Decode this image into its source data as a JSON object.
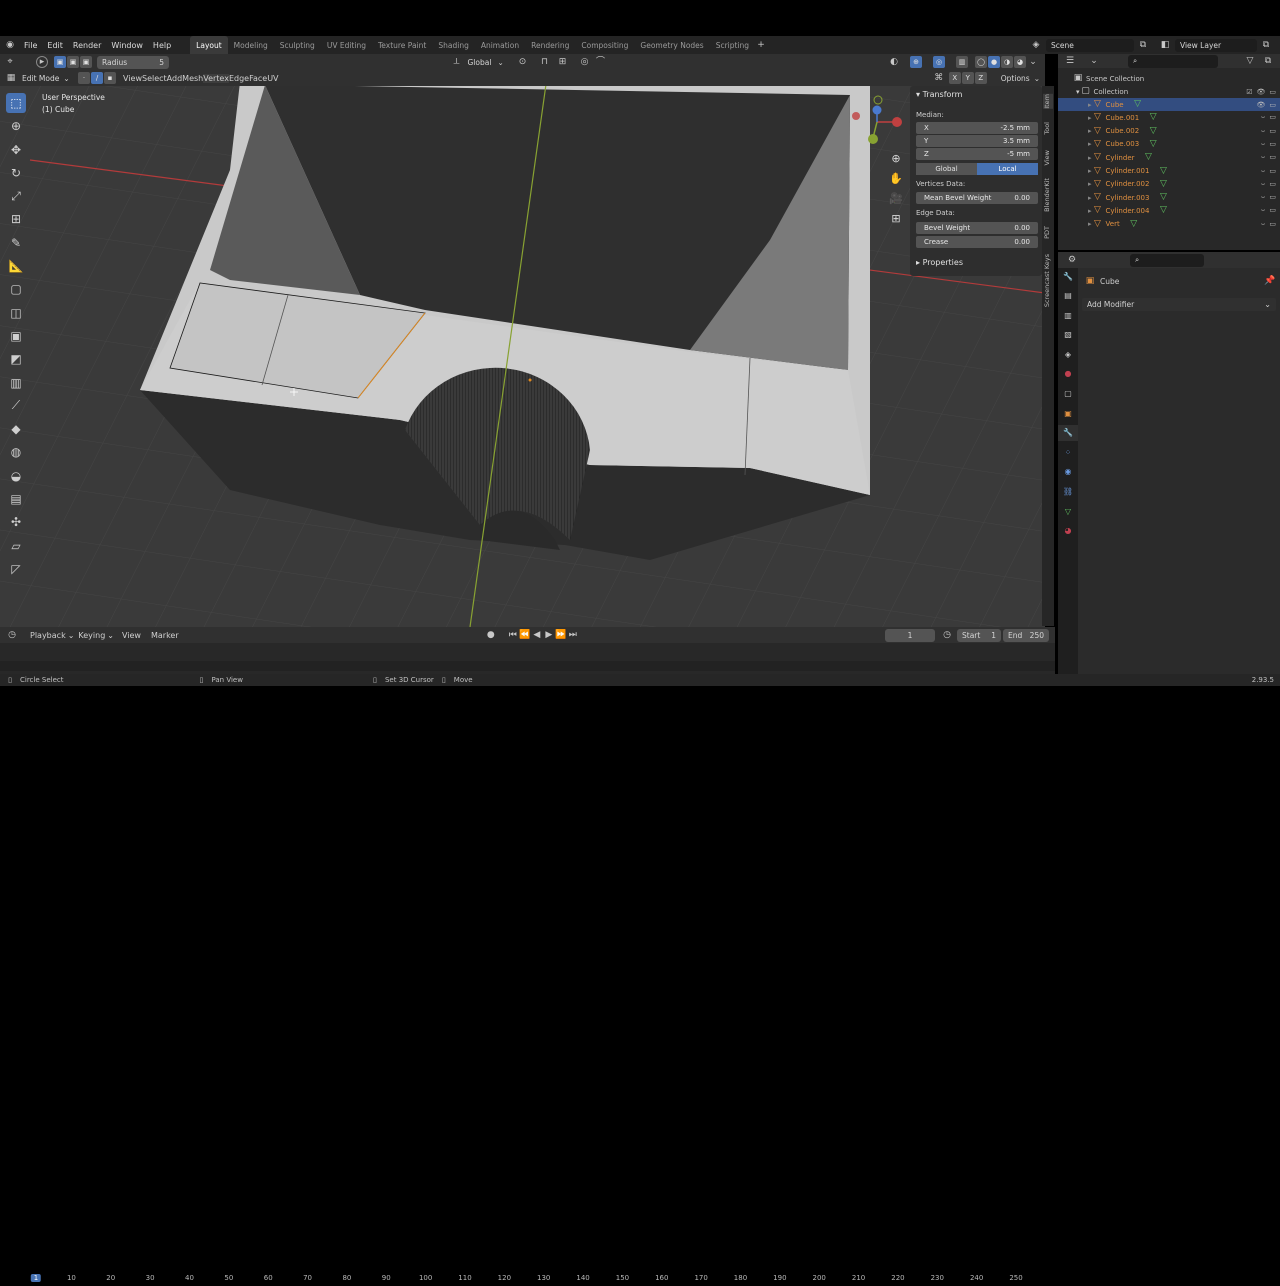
{
  "topbar": {
    "menus": [
      "File",
      "Edit",
      "Render",
      "Window",
      "Help"
    ],
    "workspaces": [
      "Layout",
      "Modeling",
      "Sculpting",
      "UV Editing",
      "Texture Paint",
      "Shading",
      "Animation",
      "Rendering",
      "Compositing",
      "Geometry Nodes",
      "Scripting"
    ],
    "active_workspace": "Layout",
    "scene": "Scene",
    "view_layer": "View Layer"
  },
  "viewport_header": {
    "mode": "Edit Mode",
    "menus": [
      "View",
      "Select",
      "Add",
      "Mesh",
      "Vertex",
      "Edge",
      "Face",
      "UV"
    ],
    "tool_setting_label": "Radius",
    "tool_setting_value": "5",
    "transform_orientation": "Global",
    "options": "Options",
    "axes": [
      "X",
      "Y",
      "Z"
    ]
  },
  "viewport": {
    "perspective": "User Perspective",
    "object": "(1) Cube"
  },
  "toolbar_icons": [
    "select-circle-icon",
    "cursor-icon",
    "move-icon",
    "rotate-icon",
    "scale-icon",
    "transform-icon",
    "annotate-icon",
    "measure-icon",
    "add-cube-icon",
    "extrude-icon",
    "inset-icon",
    "bevel-icon",
    "loop-cut-icon",
    "knife-icon",
    "poly-build-icon",
    "spin-icon",
    "smooth-icon",
    "edge-slide-icon",
    "shrink-icon",
    "shear-icon",
    "rip-icon"
  ],
  "npanel": {
    "section": "Transform",
    "median_label": "Median:",
    "x_label": "X",
    "x_value": "-2.5 mm",
    "y_label": "Y",
    "y_value": "3.5 mm",
    "z_label": "Z",
    "z_value": "-5 mm",
    "global": "Global",
    "local": "Local",
    "vertices_data": "Vertices Data:",
    "mean_bevel_label": "Mean Bevel Weight",
    "mean_bevel_value": "0.00",
    "edge_data": "Edge Data:",
    "bevel_weight_label": "Bevel Weight",
    "bevel_weight_value": "0.00",
    "crease_label": "Crease",
    "crease_value": "0.00",
    "properties": "Properties",
    "tabs": [
      "Item",
      "Tool",
      "View",
      "BlenderKit",
      "PDT",
      "Screencast Keys"
    ]
  },
  "outliner": {
    "root": "Scene Collection",
    "collection": "Collection",
    "items": [
      {
        "name": "Cube",
        "selected": true
      },
      {
        "name": "Cube.001",
        "selected": false
      },
      {
        "name": "Cube.002",
        "selected": false
      },
      {
        "name": "Cube.003",
        "selected": false
      },
      {
        "name": "Cylinder",
        "selected": false
      },
      {
        "name": "Cylinder.001",
        "selected": false
      },
      {
        "name": "Cylinder.002",
        "selected": false
      },
      {
        "name": "Cylinder.003",
        "selected": false
      },
      {
        "name": "Cylinder.004",
        "selected": false
      },
      {
        "name": "Vert",
        "selected": false
      }
    ]
  },
  "properties": {
    "object_name": "Cube",
    "add_modifier": "Add Modifier"
  },
  "timeline": {
    "menus": [
      "Playback",
      "Keying",
      "View",
      "Marker"
    ],
    "current_frame": "1",
    "start_label": "Start",
    "start_value": "1",
    "end_label": "End",
    "end_value": "250",
    "ticks": [
      "1",
      "10",
      "20",
      "30",
      "40",
      "50",
      "60",
      "70",
      "80",
      "90",
      "100",
      "110",
      "120",
      "130",
      "140",
      "150",
      "160",
      "170",
      "180",
      "190",
      "200",
      "210",
      "220",
      "230",
      "240",
      "250"
    ]
  },
  "statusbar": {
    "circle_select": "Circle Select",
    "pan_view": "Pan View",
    "set_cursor": "Set 3D Cursor",
    "move": "Move",
    "version": "2.93.5"
  },
  "colors": {
    "accent": "#4772b3",
    "viewport_bg": "#3a3a3a",
    "panel_bg": "#2e2e2e",
    "x_axis": "#c04040",
    "y_axis": "#8fb030"
  }
}
